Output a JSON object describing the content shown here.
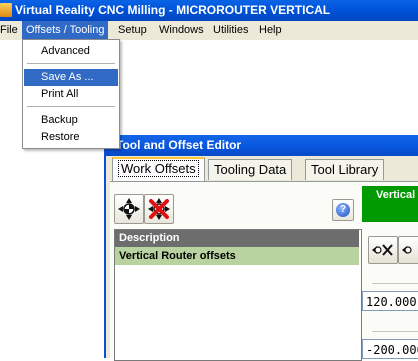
{
  "app": {
    "title": "Virtual Reality CNC Milling  -  MICROROUTER VERTICAL"
  },
  "menubar": {
    "items": [
      "File",
      "Offsets / Tooling",
      "Setup",
      "Windows",
      "Utilities",
      "Help"
    ],
    "active": "Offsets / Tooling"
  },
  "dropdown": {
    "items": [
      "Advanced",
      "Save As ...",
      "Print All",
      "Backup",
      "Restore"
    ],
    "highlighted": "Save As ..."
  },
  "editor": {
    "title": "Tool and Offset Editor",
    "tabs": [
      "Work Offsets",
      "Tooling Data",
      "Tool Library"
    ],
    "active_tab": "Work Offsets",
    "list": {
      "header": "Description",
      "rows": [
        "Vertical Router offsets"
      ]
    },
    "machine_header": "Vertical",
    "values": [
      "120.000",
      "-200.000"
    ],
    "icons": [
      "move-offset-icon",
      "delete-offset-icon",
      "help-icon",
      "set-x-icon",
      "set-next-icon"
    ]
  },
  "colors": {
    "title_bar": "#0053d9",
    "menu_highlight": "#316ac5",
    "list_row_bg": "#b9d3a0",
    "machine_header_bg": "#009900",
    "list_header_bg": "#6d6d6d"
  }
}
